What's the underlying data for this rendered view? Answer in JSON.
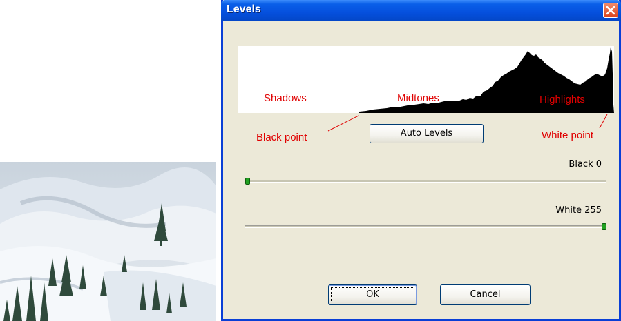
{
  "window": {
    "title": "Levels"
  },
  "histogram": {
    "labels": {
      "shadows": "Shadows",
      "midtones": "Midtones",
      "highlights": "Highlights",
      "black_point": "Black point",
      "white_point": "White point"
    }
  },
  "buttons": {
    "auto_levels": "Auto Levels",
    "ok": "OK",
    "cancel": "Cancel"
  },
  "sliders": {
    "black": {
      "label": "Black 0",
      "value": 0,
      "max": 255
    },
    "white": {
      "label": "White 255",
      "value": 255,
      "max": 255
    }
  },
  "colors": {
    "titlebar": "#0550de",
    "annotation": "#e00000",
    "dialog_bg": "#ece9d8",
    "slider_thumb": "#21a121"
  },
  "icons": {
    "close": "close-icon"
  }
}
